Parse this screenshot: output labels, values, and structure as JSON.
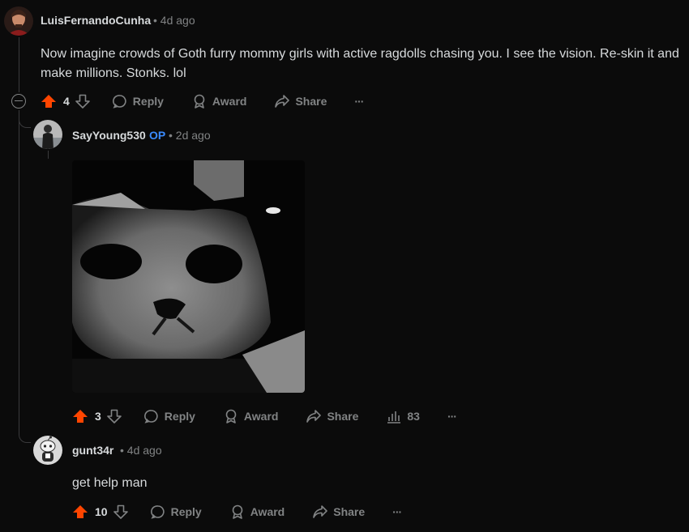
{
  "comments": [
    {
      "username": "LuisFernandoCunha",
      "meta": "• 4d ago",
      "body": "Now imagine crowds of Goth furry mommy girls with active ragdolls chasing you. I see the vision. Re-skin it and make millions. Stonks. lol",
      "votes": "4",
      "actions": {
        "reply": "Reply",
        "award": "Award",
        "share": "Share",
        "more": "···"
      }
    },
    {
      "username": "SayYoung530",
      "op_badge": "OP",
      "meta": "• 2d ago",
      "votes": "3",
      "views": "83",
      "actions": {
        "reply": "Reply",
        "award": "Award",
        "share": "Share",
        "more": "···"
      }
    },
    {
      "username": "gunt34r",
      "meta": "• 4d ago",
      "body": "get help man",
      "votes": "10",
      "actions": {
        "reply": "Reply",
        "award": "Award",
        "share": "Share",
        "more": "···"
      }
    }
  ],
  "colors": {
    "upvote": "#ff4500",
    "op": "#3a8bff",
    "background": "#0b0b0b"
  }
}
